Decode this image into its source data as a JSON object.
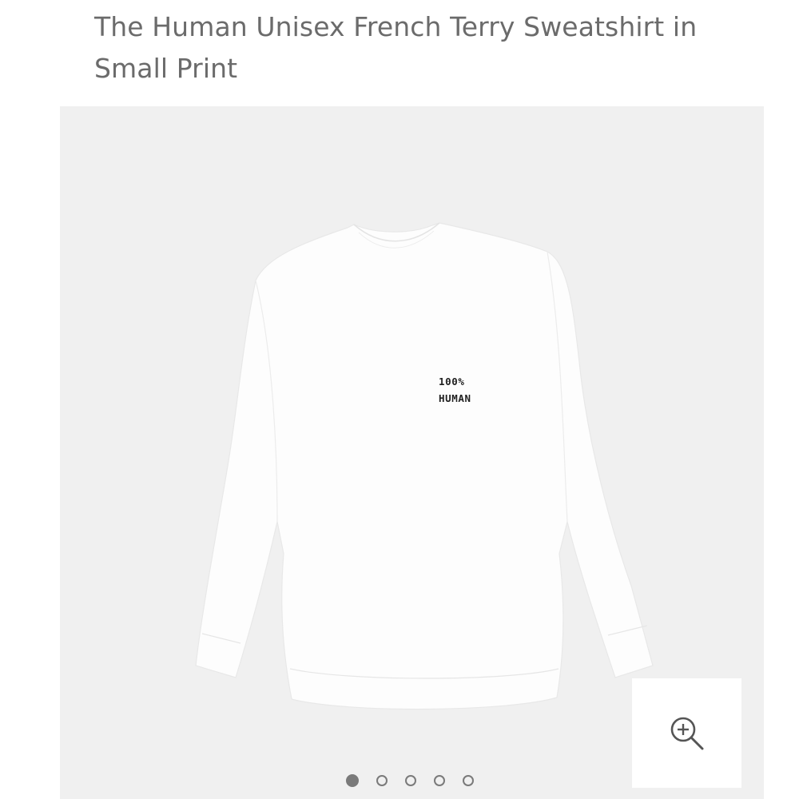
{
  "product": {
    "title": "The Human Unisex French Terry Sweatshirt in Small Print",
    "print_line_1": "100%",
    "print_line_2": "HUMAN"
  },
  "gallery": {
    "background_color": "#f0f0f0",
    "zoom_icon": "zoom-in-icon",
    "dots": [
      {
        "active": true
      },
      {
        "active": false
      },
      {
        "active": false
      },
      {
        "active": false
      },
      {
        "active": false
      }
    ]
  }
}
